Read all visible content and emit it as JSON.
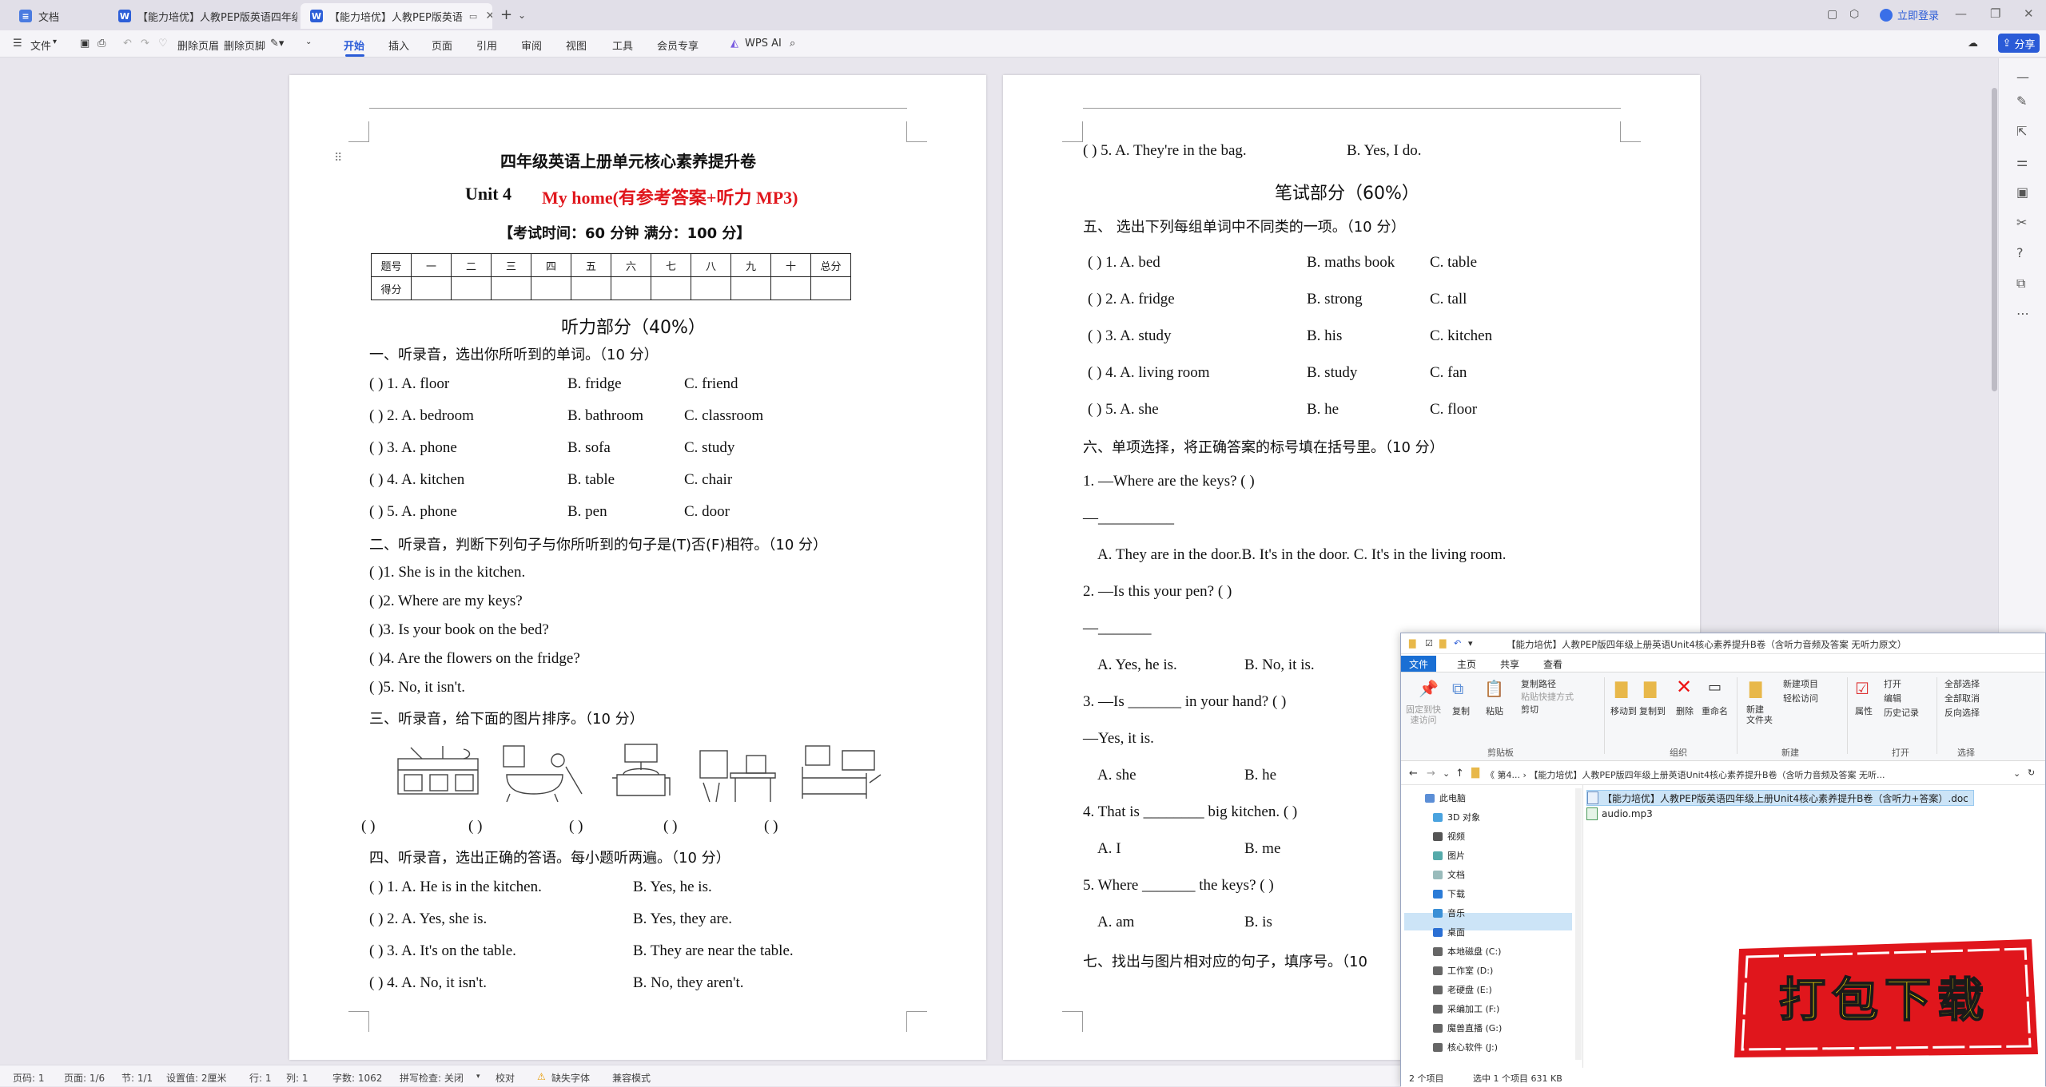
{
  "tabs": [
    {
      "label": "文档",
      "icon": "doc-home-icon"
    },
    {
      "label": "【能力培优】人教PEP版英语四年级上",
      "icon": "word-icon"
    },
    {
      "label": "【能力培优】人教PEP版英语",
      "icon": "word-icon"
    }
  ],
  "titlebar": {
    "login": "立即登录"
  },
  "toolbar": {
    "file_menu": "文件",
    "delete_header": "删除页眉",
    "delete_footer": "删除页脚",
    "items": [
      "开始",
      "插入",
      "页面",
      "引用",
      "审阅",
      "视图",
      "工具",
      "会员专享"
    ],
    "wps_ai": "WPS AI",
    "share": "分享"
  },
  "page1": {
    "title": "四年级英语上册单元核心素养提升卷",
    "unit": "Unit 4",
    "subtitle": "My home(有参考答案+听力 MP3)",
    "exam_info": "【考试时间：60 分钟  满分：100 分】",
    "score_header": [
      "题号",
      "一",
      "二",
      "三",
      "四",
      "五",
      "六",
      "七",
      "八",
      "九",
      "十",
      "总分"
    ],
    "score_row_label": "得分",
    "section_listening": "听力部分（40%）",
    "q1_title": "一、听录音，选出你所听到的单词。（10 分）",
    "q1": [
      {
        "n": "(        ) 1. A.   floor",
        "b": "B.   fridge",
        "c": "C.   friend"
      },
      {
        "n": "(        ) 2. A.   bedroom",
        "b": "B.   bathroom",
        "c": "C.   classroom"
      },
      {
        "n": "(        ) 3. A.   phone",
        "b": "B.   sofa",
        "c": "C.   study"
      },
      {
        "n": "(        ) 4. A.   kitchen",
        "b": "B.   table",
        "c": "C.   chair"
      },
      {
        "n": "(        ) 5. A.   phone",
        "b": "B.   pen",
        "c": "C.   door"
      }
    ],
    "q2_title": "二、听录音，判断下列句子与你所听到的句子是(T)否(F)相符。（10 分）",
    "q2": [
      "(        )1. She is in the kitchen.",
      "(        )2. Where are my keys?",
      "(        )3. Is your book on the bed?",
      "(        )4. Are the flowers on the fridge?",
      "(        )5. No, it isn't."
    ],
    "q3_title": "三、听录音，给下面的图片排序。（10 分）",
    "q3_blanks": [
      "(        )",
      "(        )",
      "(        )",
      "(        )",
      "(        )"
    ],
    "q4_title": "四、听录音，选出正确的答语。每小题听两遍。（10 分）",
    "q4": [
      {
        "n": "(        ) 1. A.   He is in the kitchen.",
        "b": "B.   Yes, he is."
      },
      {
        "n": "(        ) 2. A.   Yes, she is.",
        "b": "B.   Yes, they are."
      },
      {
        "n": "(        ) 3. A.   It's on the table.",
        "b": "B.   They are near the table."
      },
      {
        "n": "(        ) 4. A.   No, it isn't.",
        "b": "B.   No, they aren't."
      }
    ]
  },
  "page2": {
    "q4_5": "(        ) 5. A.   They're in the bag.",
    "q4_5b": "B.   Yes, I do.",
    "section_written": "笔试部分（60%）",
    "q5_title": "五、   选出下列每组单词中不同类的一项。（10 分）",
    "q5": [
      {
        "n": "(        )  1.  A.   bed",
        "b": "B.   maths book",
        "c": "C.   table"
      },
      {
        "n": "(        )  2.  A.   fridge",
        "b": "B.   strong",
        "c": "C.   tall"
      },
      {
        "n": "(        )  3.  A.   study",
        "b": "B.   his",
        "c": "C.   kitchen"
      },
      {
        "n": "(        )  4.  A.   living room",
        "b": "B.   study",
        "c": "C.   fan"
      },
      {
        "n": "(        )  5.  A.   she",
        "b": "B.   he",
        "c": "C.   floor"
      }
    ],
    "q6_title": "六、单项选择，将正确答案的标号填在括号里。（10 分）",
    "q6_1": "1.     —Where are the keys? (        )",
    "q6_1a": "—__________",
    "q6_1opts": "A.   They are in the door.B.   It's in the door.     C.   It's in the living room.",
    "q6_2": "2.     —Is this your pen? (        )",
    "q6_2a": "—_______",
    "q6_2optA": "A.   Yes, he is.",
    "q6_2optB": "B.   No, it is.",
    "q6_3": "3.     —Is _______ in your hand? (        )",
    "q6_3a": "—Yes, it is.",
    "q6_3optA": "A.   she",
    "q6_3optB": "B.   he",
    "q6_4": "4.     That is ________ big kitchen. (        )",
    "q6_4optA": "A.   I",
    "q6_4optB": "B.   me",
    "q6_5": "5.     Where _______ the keys? (        )",
    "q6_5optA": "A.   am",
    "q6_5optB": "B.   is",
    "q7_title": "七、找出与图片相对应的句子，填序号。（10"
  },
  "status": {
    "page": "页码: 1",
    "pages": "页面: 1/6",
    "section": "节: 1/1",
    "setting": "设置值: 2厘米",
    "row": "行: 1",
    "col": "列: 1",
    "words": "字数: 1062",
    "spell": "拼写检查: 关闭",
    "proof": "校对",
    "missing_font": "缺失字体",
    "compat": "兼容模式"
  },
  "explorer": {
    "title": "【能力培优】人教PEP版四年级上册英语Unit4核心素养提升B卷（含听力音频及答案 无听力原文）",
    "tabs": [
      "文件",
      "主页",
      "共享",
      "查看"
    ],
    "ribbon": {
      "pin": "固定到快\n速访问",
      "copy": "复制",
      "paste": "粘贴",
      "copy_path": "复制路径",
      "paste_shortcut": "粘贴快捷方式",
      "cut": "剪切",
      "group_clipboard": "剪贴板",
      "move_to": "移动到",
      "copy_to": "复制到",
      "delete": "删除",
      "rename": "重命名",
      "group_organize": "组织",
      "new_folder": "新建\n文件夹",
      "new_item": "新建项目",
      "easy_access": "轻松访问",
      "group_new": "新建",
      "properties": "属性",
      "open": "打开",
      "edit": "编辑",
      "history": "历史记录",
      "group_open": "打开",
      "select_all": "全部选择",
      "select_none": "全部取消",
      "invert": "反向选择",
      "group_select": "选择"
    },
    "address": "《  第4...  ›  【能力培优】人教PEP版四年级上册英语Unit4核心素养提升B卷（含听力音频及答案 无听...",
    "nav": [
      "此电脑",
      "3D 对象",
      "视频",
      "图片",
      "文档",
      "下载",
      "音乐",
      "桌面",
      "本地磁盘 (C:)",
      "工作室 (D:)",
      "老硬盘 (E:)",
      "采编加工 (F:)",
      "魔兽直播 (G:)",
      "核心软件 (J:)"
    ],
    "files": [
      "【能力培优】人教PEP版英语四年级上册Unit4核心素养提升B卷（含听力+答案）.doc",
      "audio.mp3"
    ],
    "status_items": "2 个项目",
    "status_selected": "选中 1 个项目  631 KB"
  },
  "banner": {
    "text": "打包下载"
  }
}
